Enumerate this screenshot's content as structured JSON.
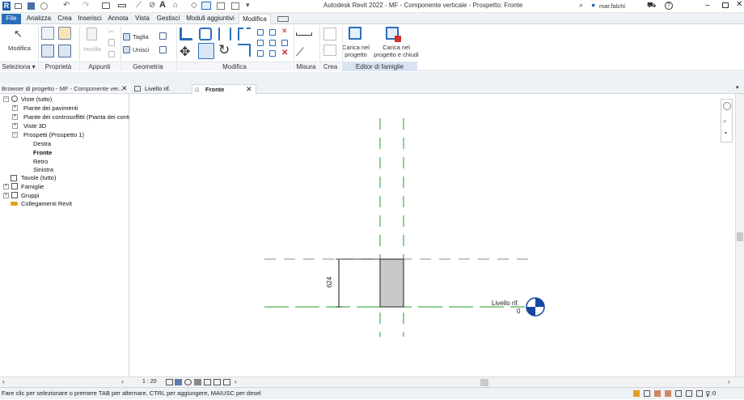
{
  "titlebar": {
    "title": "Autodesk Revit 2022 - MF - Componente verticale - Prospetto: Fronte",
    "user": "mar.falchi",
    "help": "?"
  },
  "ribbon_tabs": [
    {
      "label": "File"
    },
    {
      "label": "Analizza"
    },
    {
      "label": "Crea"
    },
    {
      "label": "Inserisci"
    },
    {
      "label": "Annota"
    },
    {
      "label": "Vista"
    },
    {
      "label": "Gestisci"
    },
    {
      "label": "Moduli aggiuntivi"
    },
    {
      "label": "Modifica"
    }
  ],
  "ribbon": {
    "modifica_btn": "Modifica",
    "incolla_btn": "Incolla",
    "taglia_btn": "Taglia",
    "unisci_btn": "Unisci",
    "carica_progetto": [
      "Carica nel",
      "progetto"
    ],
    "carica_chiudi": [
      "Carica nel",
      "progetto e chiudi"
    ],
    "panels": {
      "seleziona": "Seleziona ▾",
      "proprieta": "Proprietà",
      "appunti": "Appunti",
      "geometria": "Geometria",
      "modifica": "Modifica",
      "misura": "Misura",
      "crea": "Crea",
      "editor": "Editor di famiglie"
    }
  },
  "browser": {
    "title": "Browser di progetto - MF - Componente ver...",
    "tree": [
      {
        "label": "Viste (tutto)"
      },
      {
        "label": "Piante dei pavimenti"
      },
      {
        "label": "Piante dei controsoffitti (Pianta dei contr"
      },
      {
        "label": "Viste 3D"
      },
      {
        "label": "Prospetti (Prospetto 1)"
      },
      {
        "label": "Destra"
      },
      {
        "label": "Fronte"
      },
      {
        "label": "Retro"
      },
      {
        "label": "Sinistra"
      },
      {
        "label": "Tavole (tutto)"
      },
      {
        "label": "Famiglie"
      },
      {
        "label": "Gruppi"
      },
      {
        "label": "Collegamenti Revit"
      }
    ]
  },
  "doc_tabs": [
    {
      "label": "Livello rif."
    },
    {
      "label": "Fronte"
    }
  ],
  "canvas": {
    "dimension": "624",
    "level_name": "Livello rif.",
    "level_value": "0"
  },
  "viewbar": {
    "scale": "1 : 20"
  },
  "status": {
    "text": "Fare clic per selezionare o premere TAB per alternare, CTRL per aggiungere, MAIUSC per desel",
    "filter_count": ":0"
  },
  "colors": {
    "file_tab": "#2a6ebb",
    "ref_plane": "#1f9c2a",
    "level_marker": "#1546a0",
    "element_fill": "#c8c8c8"
  }
}
